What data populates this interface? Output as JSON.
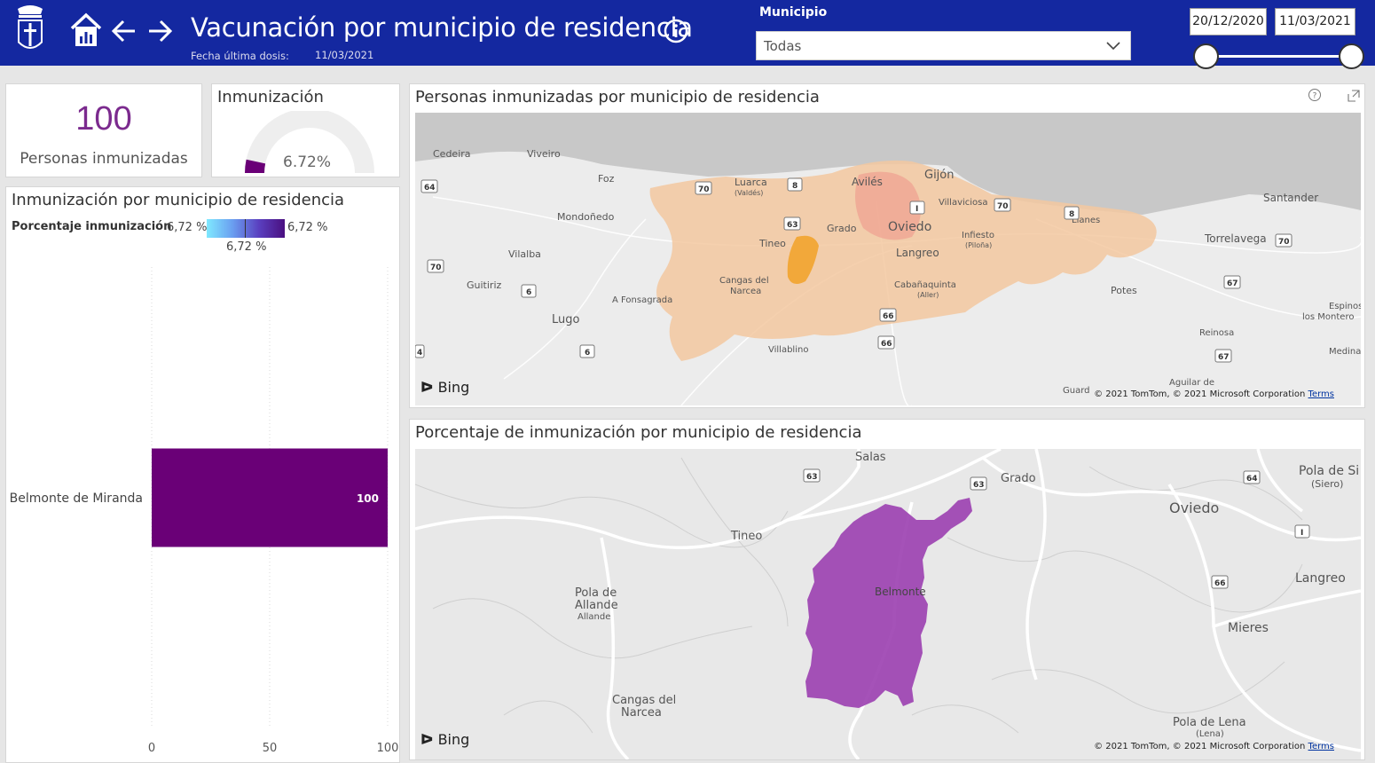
{
  "header": {
    "title": "Vacunación por municipio de residencia",
    "fecha_label": "Fecha última dosis:",
    "fecha_value": "11/03/2021",
    "municipio_label": "Municipio",
    "municipio_value": "Todas",
    "date_start": "20/12/2020",
    "date_end": "11/03/2021",
    "bg_color": "#1428a0"
  },
  "kpi": {
    "value": "100",
    "label": "Personas inmunizadas",
    "color": "#7b2a8e"
  },
  "gauge": {
    "title": "Inmunización",
    "value": "6,72%",
    "value_display": "6.72%",
    "fraction": 0.0672
  },
  "bar_panel": {
    "title": "Inmunización por municipio de residencia",
    "legend_label": "Porcentaje inmunización",
    "legend_min": "6,72 %",
    "legend_max": "6,72 %",
    "legend_mid": "6,72 %"
  },
  "chart_data": {
    "type": "bar",
    "orientation": "horizontal",
    "categories": [
      "Belmonte de Miranda"
    ],
    "values": [
      100
    ],
    "data_labels": [
      "100"
    ],
    "xticks": [
      "0",
      "50",
      "100"
    ],
    "xlim": [
      0,
      100
    ],
    "color": "#6a0077",
    "grid": true
  },
  "map1": {
    "title": "Personas inmunizadas por municipio de residencia",
    "bing": "Bing",
    "copyright": "© 2021 TomTom, © 2021 Microsoft Corporation",
    "terms": "Terms",
    "places": [
      "Cedeira",
      "Viveiro",
      "Foz",
      "Luarca",
      "(Valdés)",
      "Avilés",
      "Gijón",
      "Villaviciosa",
      "Santander",
      "Mondoñedo",
      "Tineo",
      "Grado",
      "Oviedo",
      "Infiesto",
      "(Piloña)",
      "Llanes",
      "Torrelavega",
      "Vilalba",
      "Langreo",
      "Guitiriz",
      "Cangas del",
      "Narcea",
      "Cabañaquinta",
      "(Aller)",
      "Potes",
      "A Fonsagrada",
      "Lugo",
      "Espinosa de",
      "los Montero",
      "Reinosa",
      "Villablino",
      "Medina de",
      "Aguilar de",
      "Guard"
    ],
    "roads": [
      "64",
      "70",
      "8",
      "63",
      "I",
      "70",
      "8",
      "70",
      "6",
      "67",
      "66",
      "66",
      "6",
      "67",
      "70",
      "4"
    ]
  },
  "map2": {
    "title": "Porcentaje de inmunización por municipio de residencia",
    "bing": "Bing",
    "copyright": "© 2021 TomTom, © 2021 Microsoft Corporation",
    "terms": "Terms",
    "places": [
      "Salas",
      "Grado",
      "Pola de Si",
      "(Siero)",
      "Oviedo",
      "Tineo",
      "Belmonte",
      "Langreo",
      "Pola de",
      "Allande",
      "Allande",
      "Mieres",
      "Cangas del",
      "Narcea",
      "Pola de Lena",
      "(Lena)"
    ],
    "roads": [
      "63",
      "63",
      "64",
      "I",
      "66"
    ],
    "region_color": "#9b3fb0"
  }
}
